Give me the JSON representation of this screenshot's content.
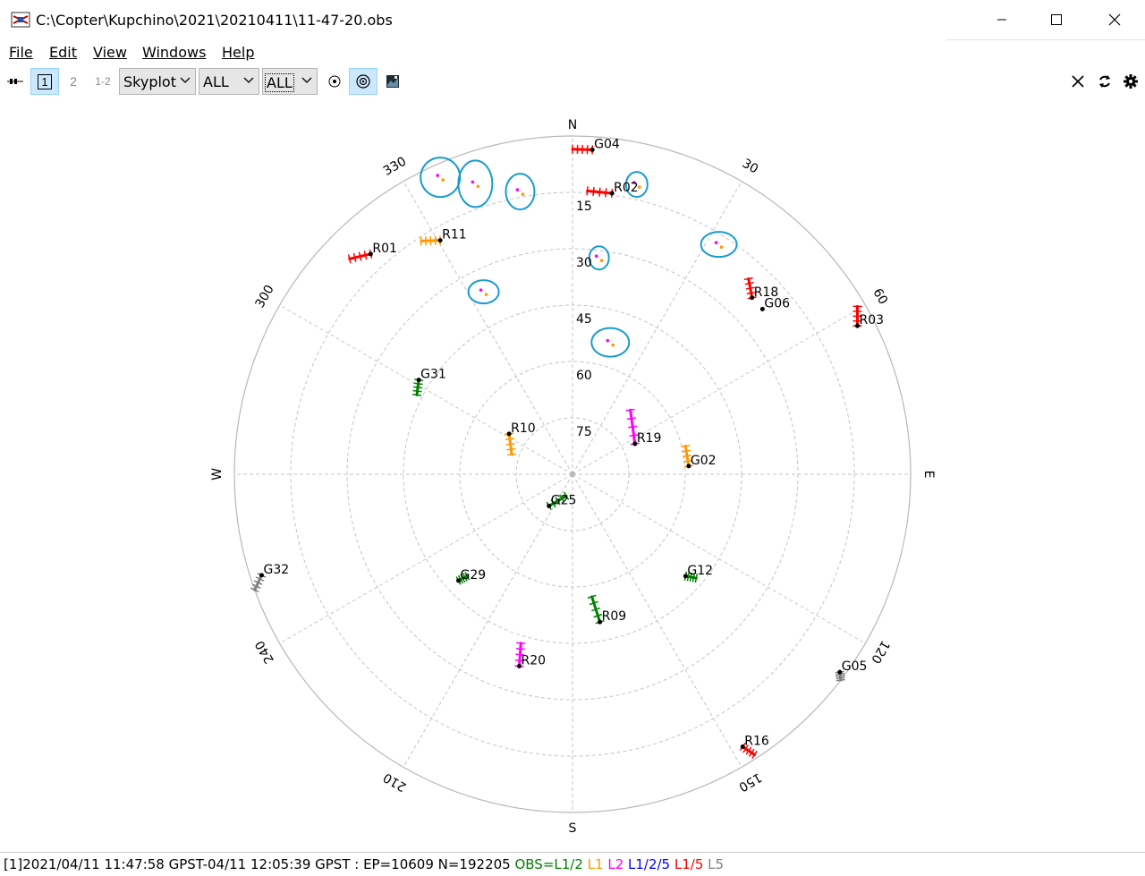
{
  "window": {
    "title": "C:\\Copter\\Kupchino\\2021\\20210411\\11-47-20.obs"
  },
  "menu": [
    {
      "name": "menu-file",
      "label": "File"
    },
    {
      "name": "menu-edit",
      "label": "Edit"
    },
    {
      "name": "menu-view",
      "label": "View"
    },
    {
      "name": "menu-windows",
      "label": "Windows"
    },
    {
      "name": "menu-help",
      "label": "Help"
    }
  ],
  "toolbar": {
    "btn1": "1",
    "btn2": "2",
    "btn12": "1-2",
    "plot_type": "Skyplot",
    "sat_select": "ALL",
    "obs_select": "ALL"
  },
  "skyplot": {
    "compass": {
      "N": "N",
      "E": "E",
      "S": "S",
      "W": "W"
    },
    "elevation_labels": [
      "15",
      "30",
      "45",
      "60",
      "75"
    ],
    "azimuth_labels": [
      "30",
      "60",
      "120",
      "150",
      "210",
      "240",
      "300",
      "330"
    ],
    "colors": {
      "L1_2": "#008000",
      "L1": "#ff9900",
      "L2": "#ff00ff",
      "L1_2_5": "#0000ff",
      "L1_5": "#ff0000",
      "L5": "#808080",
      "annotation": "#1a9bd0"
    },
    "satellites": [
      {
        "id": "G04",
        "color": "#ff0000",
        "az": 3.5,
        "el": 3.5,
        "az1": 0,
        "el1": 3.5
      },
      {
        "id": "R02",
        "color": "#ff0000",
        "az": 8,
        "el": 14.5,
        "az1": 3,
        "el1": 14.5
      },
      {
        "id": "R11",
        "color": "#ff9900",
        "az": 330.5,
        "el": 18.5,
        "az1": 327,
        "el1": 16
      },
      {
        "id": "R01",
        "color": "#ff0000",
        "az": 317.5,
        "el": 10.5,
        "az1": 314,
        "el1": 7.5
      },
      {
        "id": "R18",
        "color": "#ff0000",
        "az": 45.5,
        "el": 23,
        "az1": 42,
        "el1": 20
      },
      {
        "id": "G06",
        "color": "#ff0000",
        "az": 49,
        "el": 23
      },
      {
        "id": "R03",
        "color": "#ff0000",
        "az": 62.5,
        "el": 4.5,
        "az1": 59.5,
        "el1": 2
      },
      {
        "id": "G31",
        "color": "#008000",
        "az": 301.5,
        "el": 42,
        "az1": 297,
        "el1": 43.5
      },
      {
        "id": "R10",
        "color": "#ff9900",
        "az": 302.5,
        "el": 70,
        "az1": 288,
        "el1": 73
      },
      {
        "id": "R19",
        "color": "#ff00ff",
        "az": 64,
        "el": 71.5,
        "az1": 42,
        "el1": 67
      },
      {
        "id": "G02",
        "color": "#ff9900",
        "az": 86,
        "el": 59,
        "az1": 76,
        "el1": 59
      },
      {
        "id": "G25",
        "color": "#008000",
        "az": 216.5,
        "el": 79.5,
        "az1": 196,
        "el1": 84
      },
      {
        "id": "G12",
        "color": "#008000",
        "az": 132,
        "el": 49.5,
        "az1": 130,
        "el1": 47
      },
      {
        "id": "G29",
        "color": "#008000",
        "az": 227,
        "el": 48.5,
        "az1": 226,
        "el1": 51
      },
      {
        "id": "R09",
        "color": "#008000",
        "az": 169.5,
        "el": 50,
        "az1": 171,
        "el1": 57
      },
      {
        "id": "R20",
        "color": "#ff00ff",
        "az": 195.5,
        "el": 37,
        "az1": 197,
        "el1": 43
      },
      {
        "id": "G32",
        "color": "#808080",
        "az": 252,
        "el": 3,
        "az1": 250,
        "el1": 0
      },
      {
        "id": "G05",
        "color": "#808080",
        "az": 126.5,
        "el": 1.5,
        "az1": 127.5,
        "el1": 0
      },
      {
        "id": "R16",
        "color": "#ff0000",
        "az": 148,
        "el": 4.5,
        "az1": 147,
        "el1": 1
      }
    ],
    "marker_groups": [
      {
        "az": 336,
        "el": 3.5,
        "rx": 22,
        "ry": 22
      },
      {
        "az": 349.5,
        "el": 13.5,
        "rx": 16,
        "ry": 20
      },
      {
        "az": 341.5,
        "el": 8.5,
        "rx": 19,
        "ry": 26
      },
      {
        "az": 12.5,
        "el": 11,
        "rx": 12,
        "ry": 14
      },
      {
        "az": 32.5,
        "el": 17.5,
        "rx": 20,
        "ry": 14
      },
      {
        "az": 7,
        "el": 32,
        "rx": 11,
        "ry": 13
      },
      {
        "az": 334,
        "el": 36,
        "rx": 17,
        "ry": 13
      },
      {
        "az": 16,
        "el": 53.5,
        "rx": 21,
        "ry": 16
      }
    ]
  },
  "status": {
    "epoch_text": "[1]2021/04/11 11:47:58 GPST-04/11 12:05:39 GPST : EP=10609 N=192205 ",
    "legend": [
      {
        "label": "OBS=L1/2",
        "color": "#008000"
      },
      {
        "label": "L1",
        "color": "#ff9900"
      },
      {
        "label": "L2",
        "color": "#ff00ff"
      },
      {
        "label": "L1/2/5",
        "color": "#0000ff"
      },
      {
        "label": "L1/5",
        "color": "#ff0000"
      },
      {
        "label": "L5",
        "color": "#808080"
      }
    ]
  }
}
